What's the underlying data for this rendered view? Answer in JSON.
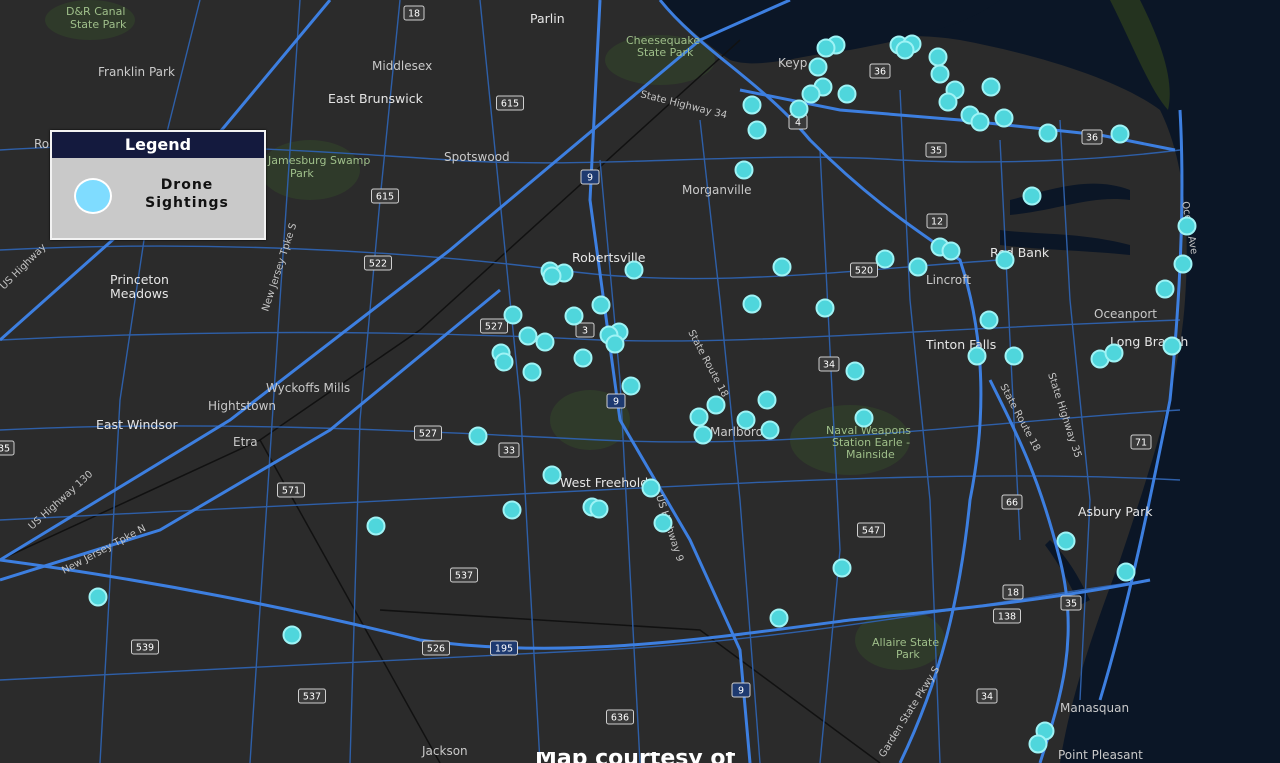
{
  "legend": {
    "title": "Legend",
    "label": "Drone Sightings"
  },
  "credit": "Map courtesy of",
  "colors": {
    "marker": "#4fd6dc",
    "marker_stroke": "#9ff3f5",
    "road": "#3a78d0",
    "land": "#2a2a2a",
    "water": "#0b1626"
  },
  "places": [
    {
      "name": "D&R Canal",
      "style": "green"
    },
    {
      "name": "State Park",
      "style": "green"
    },
    {
      "name": "Franklin Park",
      "style": "normal"
    },
    {
      "name": "Middlesex",
      "style": "normal"
    },
    {
      "name": "East Brunswick",
      "style": "big"
    },
    {
      "name": "Parlin",
      "style": "big"
    },
    {
      "name": "Cheesequake",
      "style": "green"
    },
    {
      "name": "State Park",
      "style": "green"
    },
    {
      "name": "Keyp",
      "style": "normal"
    },
    {
      "name": "Jamesburg Swamp",
      "style": "green"
    },
    {
      "name": "Park",
      "style": "green"
    },
    {
      "name": "Spotswood",
      "style": "normal"
    },
    {
      "name": "Morganville",
      "style": "normal"
    },
    {
      "name": "Princeton",
      "style": "big"
    },
    {
      "name": "Meadows",
      "style": "big"
    },
    {
      "name": "Robertsville",
      "style": "big"
    },
    {
      "name": "Red Bank",
      "style": "big"
    },
    {
      "name": "Lincroft",
      "style": "normal"
    },
    {
      "name": "Oceanport",
      "style": "normal"
    },
    {
      "name": "Long Branch",
      "style": "big"
    },
    {
      "name": "Tinton Falls",
      "style": "big"
    },
    {
      "name": "Wyckoffs Mills",
      "style": "normal"
    },
    {
      "name": "Hightstown",
      "style": "normal"
    },
    {
      "name": "East Windsor",
      "style": "big"
    },
    {
      "name": "Etra",
      "style": "normal"
    },
    {
      "name": "Marlboro",
      "style": "normal"
    },
    {
      "name": "Naval Weapons",
      "style": "green"
    },
    {
      "name": "Station Earle -",
      "style": "green"
    },
    {
      "name": "Mainside",
      "style": "green"
    },
    {
      "name": "West Freehold",
      "style": "big"
    },
    {
      "name": "Asbury Park",
      "style": "big"
    },
    {
      "name": "Allaire State",
      "style": "green"
    },
    {
      "name": "Park",
      "style": "green"
    },
    {
      "name": "Manasquan",
      "style": "normal"
    },
    {
      "name": "Point Pleasant",
      "style": "normal"
    },
    {
      "name": "Jackson",
      "style": "normal"
    },
    {
      "name": "Ro",
      "style": "normal"
    }
  ],
  "shields": [
    "18",
    "615",
    "9",
    "615",
    "522",
    "527",
    "3",
    "9",
    "520",
    "12",
    "36",
    "36",
    "4",
    "35",
    "34",
    "33",
    "527",
    "571",
    "537",
    "526",
    "195",
    "539",
    "537",
    "636",
    "9",
    "547",
    "66",
    "71",
    "35",
    "18",
    "138",
    "34",
    "35"
  ],
  "highway_labels": [
    "State Highway 34",
    "US Highway",
    "New Jersey Tpke S",
    "US Highway 130",
    "New Jersey Tpke N",
    "State Route 18",
    "US Highway 9",
    "State Route 18",
    "State Highway 35",
    "Garden State Pkwy S",
    "Ocean Ave"
  ]
}
